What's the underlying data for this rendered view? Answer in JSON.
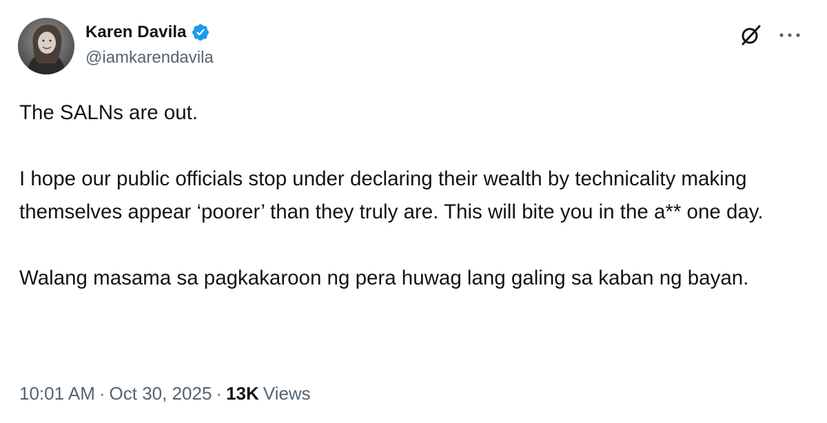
{
  "author": {
    "display_name": "Karen Davila",
    "handle": "@iamkarendavila",
    "verified": true,
    "avatar_icon": "profile-photo"
  },
  "actions": {
    "grok_icon": "grok-icon",
    "more_icon": "more-options-icon"
  },
  "tweet": {
    "paragraphs": [
      "The SALNs are out.",
      "I hope our public officials stop under declaring their wealth by technicality making themselves appear ‘poorer’ than they truly are. This will bite you in the a** one day.",
      "Walang masama sa pagkakaroon ng pera huwag lang galing sa kaban ng bayan."
    ]
  },
  "meta": {
    "time": "10:01 AM",
    "separator": "·",
    "date": "Oct 30, 2025",
    "views_count": "13K",
    "views_label": "Views"
  },
  "colors": {
    "text": "#0f1419",
    "secondary": "#536471",
    "verified_blue": "#1d9bf0"
  }
}
